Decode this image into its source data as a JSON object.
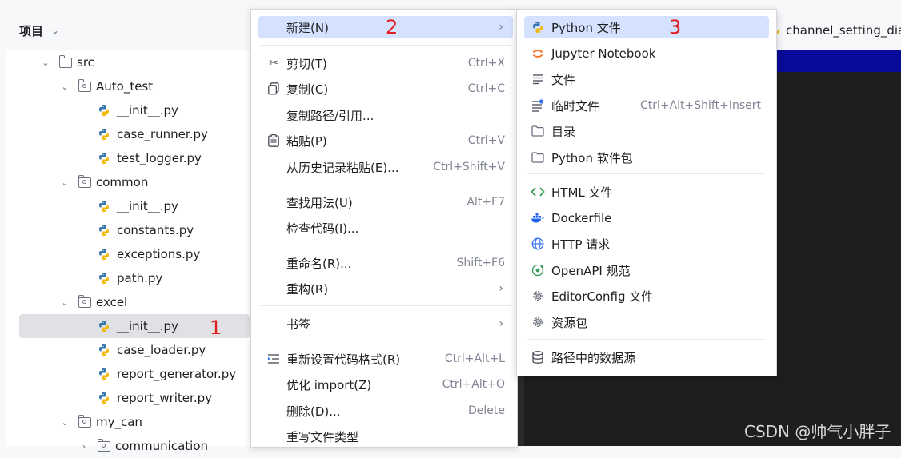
{
  "project_panel": {
    "title": "项目",
    "tree": [
      {
        "label": "src",
        "type": "folder",
        "depth": 0
      },
      {
        "label": "Auto_test",
        "type": "package",
        "depth": 1
      },
      {
        "label": "__init__.py",
        "type": "python",
        "depth": 2
      },
      {
        "label": "case_runner.py",
        "type": "python",
        "depth": 2
      },
      {
        "label": "test_logger.py",
        "type": "python",
        "depth": 2
      },
      {
        "label": "common",
        "type": "package",
        "depth": 1
      },
      {
        "label": "__init__.py",
        "type": "python",
        "depth": 2
      },
      {
        "label": "constants.py",
        "type": "python",
        "depth": 2
      },
      {
        "label": "exceptions.py",
        "type": "python",
        "depth": 2
      },
      {
        "label": "path.py",
        "type": "python",
        "depth": 2
      },
      {
        "label": "excel",
        "type": "package",
        "depth": 1
      },
      {
        "label": "__init__.py",
        "type": "python",
        "depth": 2,
        "selected": true
      },
      {
        "label": "case_loader.py",
        "type": "python",
        "depth": 2
      },
      {
        "label": "report_generator.py",
        "type": "python",
        "depth": 2
      },
      {
        "label": "report_writer.py",
        "type": "python",
        "depth": 2
      },
      {
        "label": "my_can",
        "type": "package",
        "depth": 1
      },
      {
        "label": "communication",
        "type": "package",
        "depth": 2
      }
    ]
  },
  "context_menu": {
    "items": [
      {
        "label": "新建(N)",
        "shortcut": "",
        "icon": "none",
        "submenu": true,
        "highlighted": true
      },
      {
        "label": "剪切(T)",
        "shortcut": "Ctrl+X",
        "icon": "scissors-icon"
      },
      {
        "label": "复制(C)",
        "shortcut": "Ctrl+C",
        "icon": "copy-icon"
      },
      {
        "label": "复制路径/引用...",
        "shortcut": "",
        "icon": "none"
      },
      {
        "label": "粘贴(P)",
        "shortcut": "Ctrl+V",
        "icon": "clipboard-icon"
      },
      {
        "label": "从历史记录粘贴(E)...",
        "shortcut": "Ctrl+Shift+V",
        "icon": "none"
      },
      {
        "label": "查找用法(U)",
        "shortcut": "Alt+F7",
        "icon": "none"
      },
      {
        "label": "检查代码(I)...",
        "shortcut": "",
        "icon": "none"
      },
      {
        "label": "重命名(R)...",
        "shortcut": "Shift+F6",
        "icon": "none"
      },
      {
        "label": "重构(R)",
        "shortcut": "",
        "icon": "none",
        "submenu": true
      },
      {
        "label": "书签",
        "shortcut": "",
        "icon": "none",
        "submenu": true
      },
      {
        "label": "重新设置代码格式(R)",
        "shortcut": "Ctrl+Alt+L",
        "icon": "reformat-icon"
      },
      {
        "label": "优化 import(Z)",
        "shortcut": "Ctrl+Alt+O",
        "icon": "none"
      },
      {
        "label": "删除(D)...",
        "shortcut": "Delete",
        "icon": "none"
      },
      {
        "label": "重写文件类型",
        "shortcut": "",
        "icon": "none"
      }
    ]
  },
  "submenu": {
    "items": [
      {
        "label": "Python 文件",
        "shortcut": "",
        "icon": "python-icon",
        "highlighted": true
      },
      {
        "label": "Jupyter Notebook",
        "shortcut": "",
        "icon": "jupyter-icon"
      },
      {
        "label": "文件",
        "shortcut": "",
        "icon": "file-icon"
      },
      {
        "label": "临时文件",
        "shortcut": "Ctrl+Alt+Shift+Insert",
        "icon": "scratch-file-icon"
      },
      {
        "label": "目录",
        "shortcut": "",
        "icon": "folder-icon"
      },
      {
        "label": "Python 软件包",
        "shortcut": "",
        "icon": "package-icon"
      },
      {
        "label": "HTML 文件",
        "shortcut": "",
        "icon": "html-icon"
      },
      {
        "label": "Dockerfile",
        "shortcut": "",
        "icon": "docker-icon"
      },
      {
        "label": "HTTP 请求",
        "shortcut": "",
        "icon": "globe-icon"
      },
      {
        "label": "OpenAPI 规范",
        "shortcut": "",
        "icon": "openapi-icon"
      },
      {
        "label": "EditorConfig 文件",
        "shortcut": "",
        "icon": "gear-icon"
      },
      {
        "label": "资源包",
        "shortcut": "",
        "icon": "gear-icon"
      },
      {
        "label": "路径中的数据源",
        "shortcut": "",
        "icon": "database-icon"
      }
    ]
  },
  "editor": {
    "tab_label": "channel_setting_dial"
  },
  "annotations": [
    "1",
    "2",
    "3"
  ],
  "watermark": "CSDN @帅气小胖子",
  "colors": {
    "highlight": "#d4e2ff",
    "selection": "#dfe1e5",
    "annotation": "#e02020",
    "editor_bg": "#1e1e1e",
    "editor_stripe": "#0a0a9a"
  }
}
